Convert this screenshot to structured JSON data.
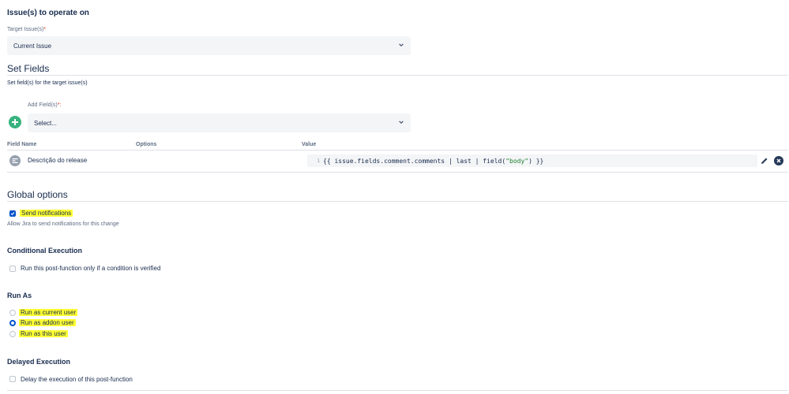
{
  "operate": {
    "heading": "Issue(s) to operate on",
    "target_label": "Target Issue(s)",
    "required_mark": "*",
    "target_value": "Current Issue"
  },
  "set_fields": {
    "title": "Set Fields",
    "subtitle": "Set field(s) for the target issue(s)",
    "add_label": "Add Field(s)",
    "required_mark": "*:",
    "add_placeholder": "Select...",
    "columns": {
      "name": "Field Name",
      "options": "Options",
      "value": "Value"
    },
    "row": {
      "field_name": "Descrição do release",
      "line_number": "1",
      "code_prefix": "{{ issue.fields.comment.comments | last | field(",
      "code_string": "\"body\"",
      "code_suffix": ") }}"
    }
  },
  "global_options": {
    "title": "Global options",
    "send_notifications_label": "Send notifications",
    "send_notifications_checked": true,
    "send_notifications_desc": "Allow Jira to send notifications for this change"
  },
  "conditional": {
    "heading": "Conditional Execution",
    "label": "Run this post-function only if a condition is verified",
    "checked": false
  },
  "run_as": {
    "heading": "Run As",
    "options": [
      {
        "label": "Run as current user",
        "checked": false
      },
      {
        "label": "Run as addon user",
        "checked": true
      },
      {
        "label": "Run as this user",
        "checked": false
      }
    ]
  },
  "delayed": {
    "heading": "Delayed Execution",
    "label": "Delay the execution of this post-function",
    "checked": false
  },
  "colors": {
    "accent": "#0052cc",
    "add_button": "#36b37e",
    "highlight": "#ffff33",
    "code_string": "#1c7d2c"
  },
  "icons": [
    "chevron-down-icon",
    "add-icon",
    "field-type-icon",
    "edit-icon",
    "remove-icon"
  ]
}
